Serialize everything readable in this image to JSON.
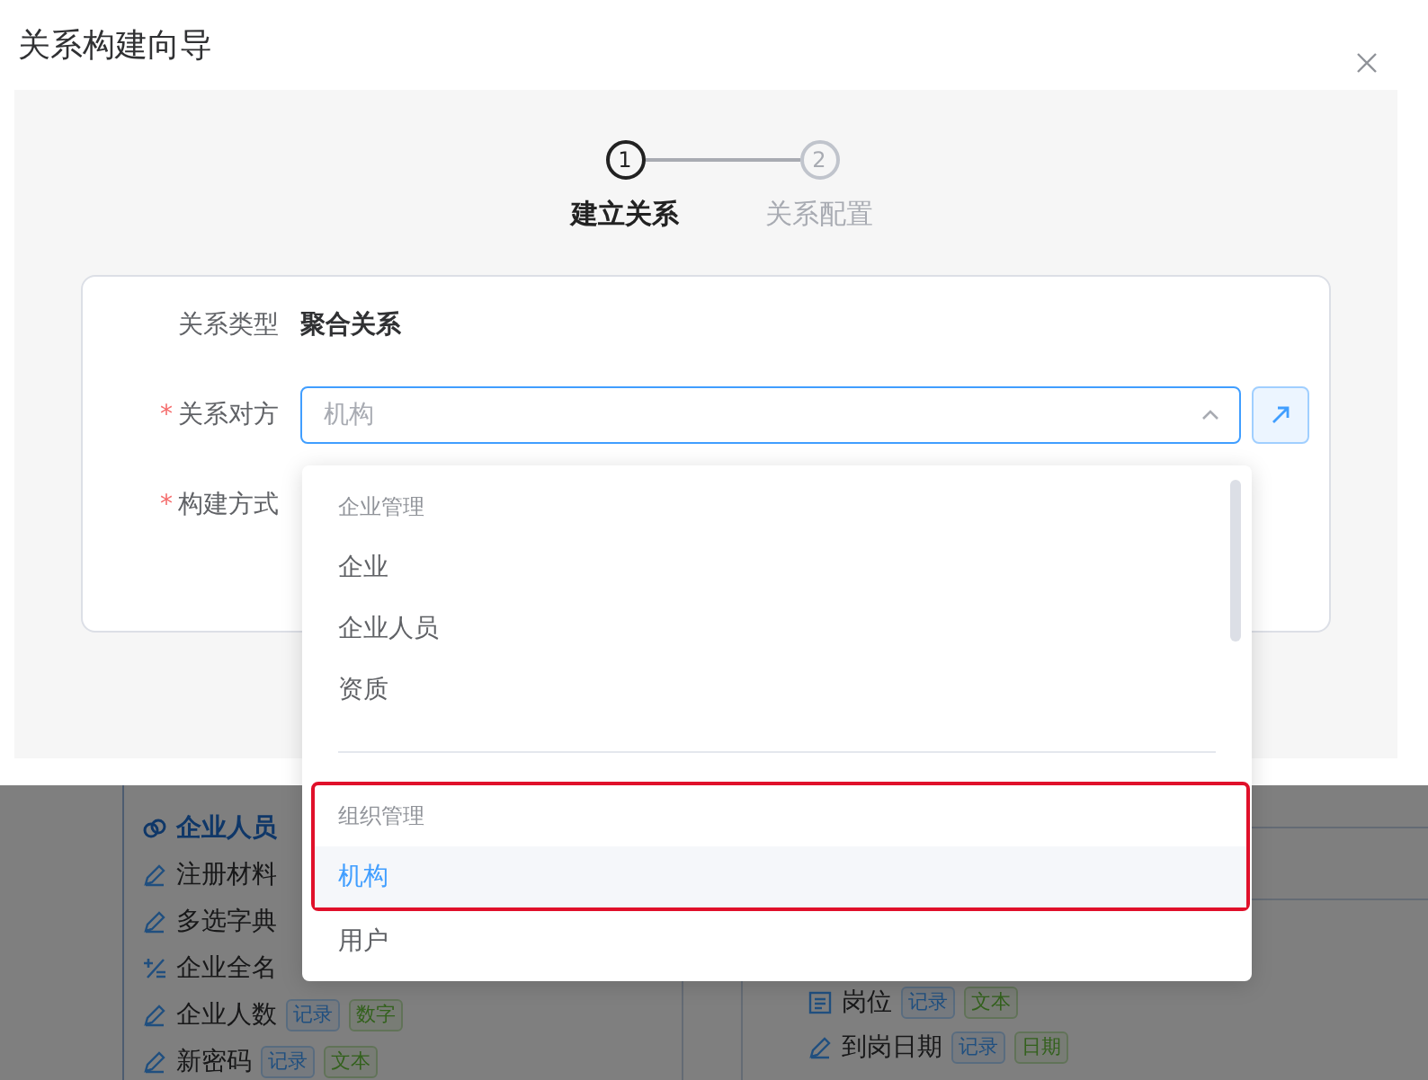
{
  "background": {
    "left_list": [
      {
        "label": "企业人员",
        "kind": "link",
        "selected": true
      },
      {
        "label": "注册材料",
        "kind": "pencil",
        "selected": false
      },
      {
        "label": "多选字典",
        "kind": "pencil",
        "selected": false
      },
      {
        "label": "企业全名",
        "kind": "formula",
        "selected": false
      },
      {
        "label": "企业人数",
        "kind": "pencil",
        "selected": false,
        "tags": [
          {
            "label": "记录",
            "kind": "source"
          },
          {
            "label": "数字",
            "kind": "datatype"
          }
        ]
      },
      {
        "label": "新密码",
        "kind": "pencil",
        "selected": false,
        "tags": [
          {
            "label": "记录",
            "kind": "source"
          },
          {
            "label": "文本",
            "kind": "datatype"
          }
        ]
      }
    ],
    "right_list": [
      {
        "label": "岗位",
        "kind": "list",
        "selected": false,
        "tags": [
          {
            "label": "记录",
            "kind": "source"
          },
          {
            "label": "文本",
            "kind": "datatype"
          }
        ]
      },
      {
        "label": "到岗日期",
        "kind": "pencil",
        "selected": false,
        "tags": [
          {
            "label": "记录",
            "kind": "source"
          },
          {
            "label": "日期",
            "kind": "datatype"
          }
        ]
      }
    ]
  },
  "dialog": {
    "title": "关系构建向导",
    "steps": [
      {
        "number": "1",
        "label": "建立关系",
        "selected": true
      },
      {
        "number": "2",
        "label": "关系配置",
        "selected": false
      }
    ],
    "rows": [
      {
        "kind": "text",
        "label": "关系类型",
        "value": "聚合关系"
      },
      {
        "kind": "select",
        "label": "关系对方",
        "required_mark": "*",
        "placeholder": "机构",
        "expanded": true
      },
      {
        "kind": "label",
        "label": "构建方式",
        "required_mark": "*"
      }
    ],
    "dropdown": {
      "groups": [
        {
          "title": "企业管理",
          "highlighted": false,
          "options": [
            {
              "label": "企业",
              "selected": false,
              "highlighted": false
            },
            {
              "label": "企业人员",
              "selected": false,
              "highlighted": false
            },
            {
              "label": "资质",
              "selected": false,
              "highlighted": false
            }
          ]
        },
        {
          "title": "组织管理",
          "highlighted": true,
          "options": [
            {
              "label": "机构",
              "selected": true,
              "highlighted": true
            },
            {
              "label": "用户",
              "selected": false,
              "highlighted": false
            }
          ]
        }
      ]
    }
  }
}
